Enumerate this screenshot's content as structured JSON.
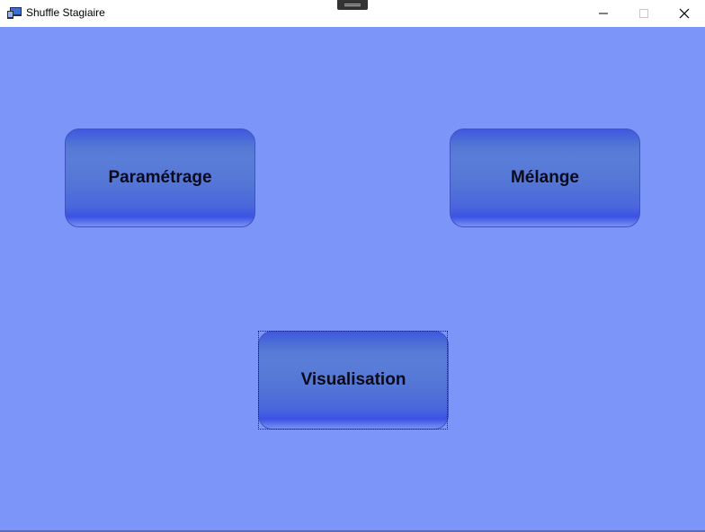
{
  "window": {
    "title": "Shuffle Stagiaire",
    "background_color": "#7b95f9",
    "controls": {
      "minimize": "minimize-icon",
      "maximize": "maximize-icon",
      "close": "close-icon"
    }
  },
  "buttons": {
    "parametrage": "Paramétrage",
    "melange": "Mélange",
    "visualisation": "Visualisation"
  },
  "focused_button": "visualisation"
}
